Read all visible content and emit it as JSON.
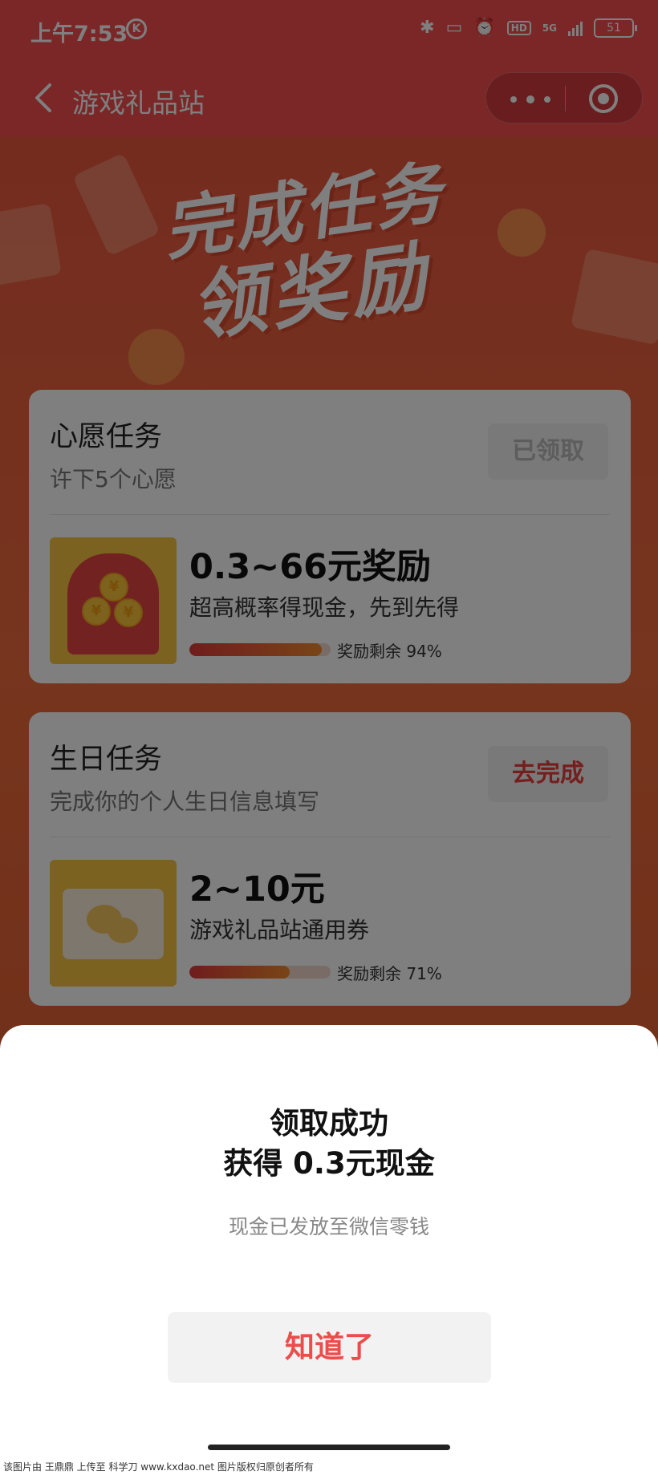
{
  "status_bar": {
    "time": "上午7:53",
    "k_badge": "K",
    "hd": "HD",
    "network": "5G",
    "battery": "51"
  },
  "nav": {
    "title": "游戏礼品站"
  },
  "banner": {
    "line1": "完成任务",
    "line2": "领奖励"
  },
  "tasks": [
    {
      "title": "心愿任务",
      "subtitle": "许下5个心愿",
      "button_label": "已领取",
      "reward_title": "0.3~66元奖励",
      "reward_desc": "超高概率得现金，先到先得",
      "progress_label": "奖励剩余 94%",
      "progress_fraction": 0.94
    },
    {
      "title": "生日任务",
      "subtitle": "完成你的个人生日信息填写",
      "button_label": "去完成",
      "reward_title": "2~10元",
      "reward_desc": "游戏礼品站通用券",
      "progress_label": "奖励剩余 71%",
      "progress_fraction": 0.71
    }
  ],
  "sheet": {
    "title": "领取成功",
    "amount": "获得 0.3元现金",
    "note": "现金已发放至微信零钱",
    "ok_label": "知道了"
  },
  "watermark": "该图片由 王鼎鼎 上传至 科学刀 www.kxdao.net 图片版权归原创者所有",
  "colors": {
    "brand_red": "#f64f51",
    "accent_red": "#ee4b4b",
    "coin_yellow": "#f8c43a"
  },
  "icons": [
    "back-icon",
    "more-icon",
    "close-mini-program-icon",
    "bluetooth-icon",
    "alarm-icon",
    "signal-icon",
    "battery-icon"
  ]
}
